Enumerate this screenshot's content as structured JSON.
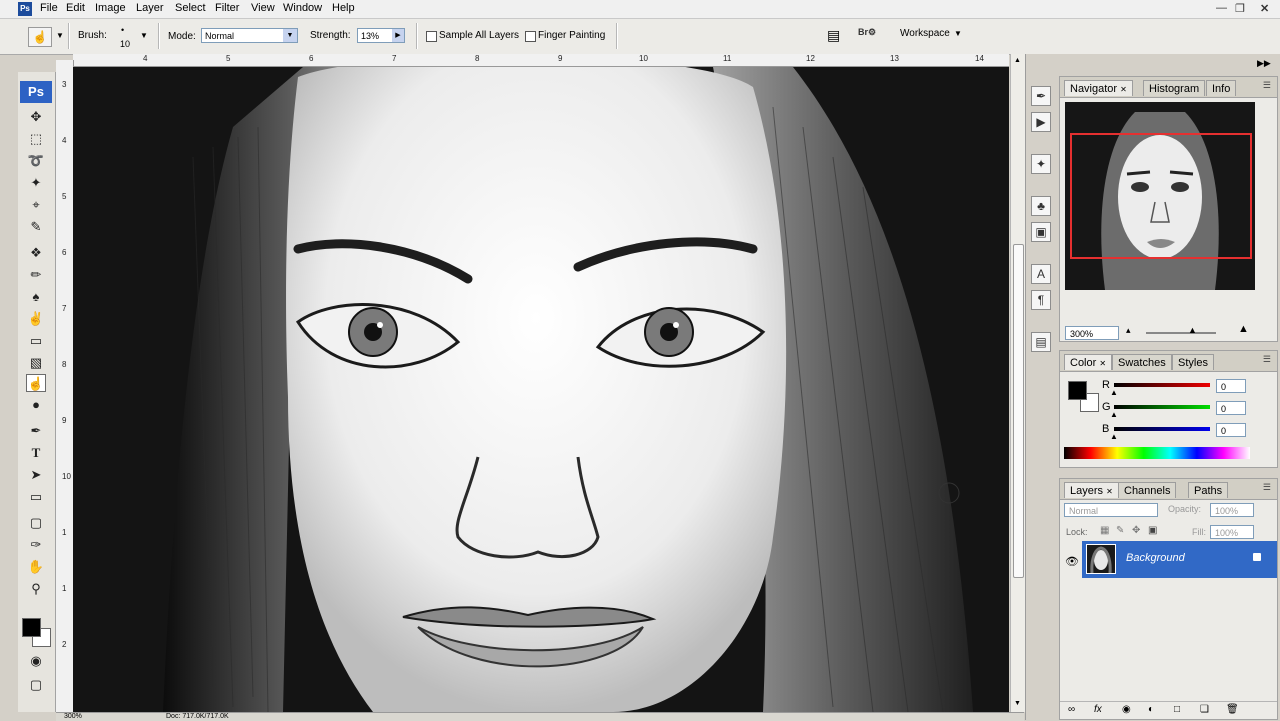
{
  "menubar": {
    "app_icon": "photoshop-icon",
    "items": [
      "File",
      "Edit",
      "Image",
      "Layer",
      "Select",
      "Filter",
      "View",
      "Window",
      "Help"
    ]
  },
  "options": {
    "brush_label": "Brush:",
    "brush_size": "10",
    "mode_label": "Mode:",
    "mode_value": "Normal",
    "strength_label": "Strength:",
    "strength_value": "13%",
    "sample_all_layers": "Sample All Layers",
    "finger_painting": "Finger Painting",
    "workspace": "Workspace"
  },
  "toolbox": {
    "logo": "Ps"
  },
  "rulers": {
    "top": [
      "4",
      "5",
      "6",
      "7",
      "8",
      "9",
      "10",
      "11",
      "12",
      "13",
      "14"
    ],
    "left": [
      "3",
      "4",
      "5",
      "6",
      "7",
      "8",
      "9",
      "10",
      "1",
      "1",
      "2"
    ]
  },
  "status": {
    "zoom": "300%",
    "doc": "Doc: 717.0K/717.0K"
  },
  "navigator": {
    "tabs": [
      "Navigator",
      "Histogram",
      "Info"
    ],
    "zoom": "300%"
  },
  "color": {
    "tabs": [
      "Color",
      "Swatches",
      "Styles"
    ],
    "channels": [
      {
        "label": "R",
        "value": "0",
        "color": "#d11a1a"
      },
      {
        "label": "G",
        "value": "0",
        "color": "#1bb51b"
      },
      {
        "label": "B",
        "value": "0",
        "color": "#1a1ad1"
      }
    ],
    "foreground": "#000000",
    "background": "#ffffff"
  },
  "layers": {
    "tabs": [
      "Layers",
      "Channels",
      "Paths"
    ],
    "blend": "Normal",
    "opacity_label": "Opacity:",
    "opacity": "100%",
    "lock_label": "Lock:",
    "fill_label": "Fill:",
    "fill": "100%",
    "layer_name": "Background"
  }
}
